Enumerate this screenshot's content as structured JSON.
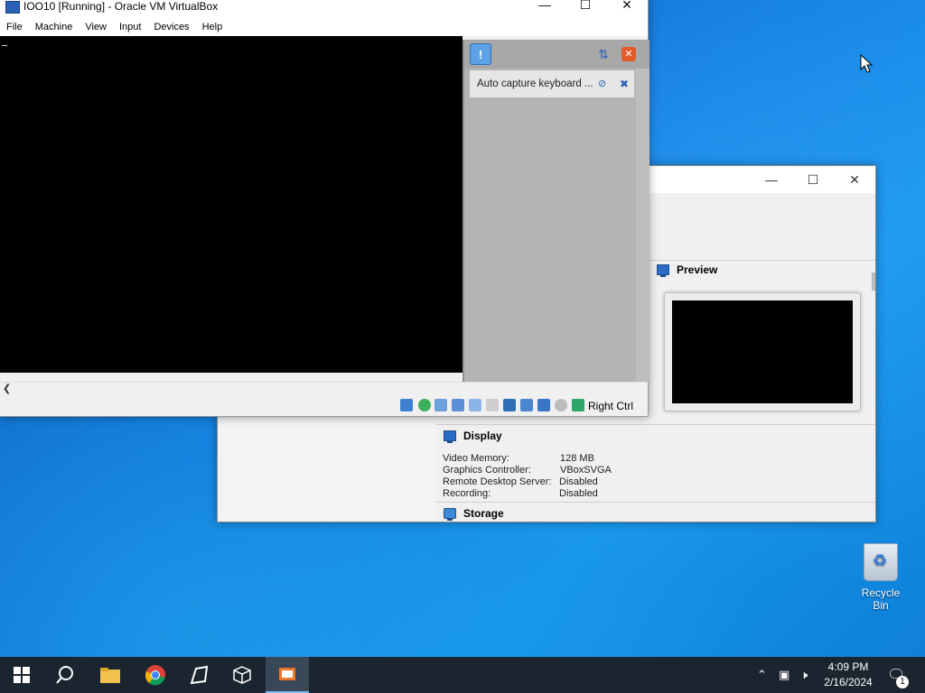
{
  "manager": {
    "preview_title": "Preview",
    "display_title": "Display",
    "storage_title": "Storage",
    "display_rows": [
      {
        "label": "Video Memory:",
        "value": "128 MB"
      },
      {
        "label": "Graphics Controller:",
        "value": "VBoxSVGA"
      },
      {
        "label": "Remote Desktop Server:",
        "value": "Disabled"
      },
      {
        "label": "Recording:",
        "value": "Disabled"
      }
    ]
  },
  "vm_window": {
    "title": "IOO10 [Running] - Oracle VM VirtualBox",
    "menu": [
      "File",
      "Machine",
      "View",
      "Input",
      "Devices",
      "Help"
    ],
    "notification_text": "Auto capture keyboard ...",
    "host_key_label": "Right Ctrl"
  },
  "desktop": {
    "recycle_bin_label": "Recycle Bin"
  },
  "taskbar": {
    "time": "4:09 PM",
    "date": "2/16/2024",
    "notification_count": "1"
  },
  "colors": {
    "accent": "#2b62b8",
    "taskbar_bg": "#1b2530"
  }
}
